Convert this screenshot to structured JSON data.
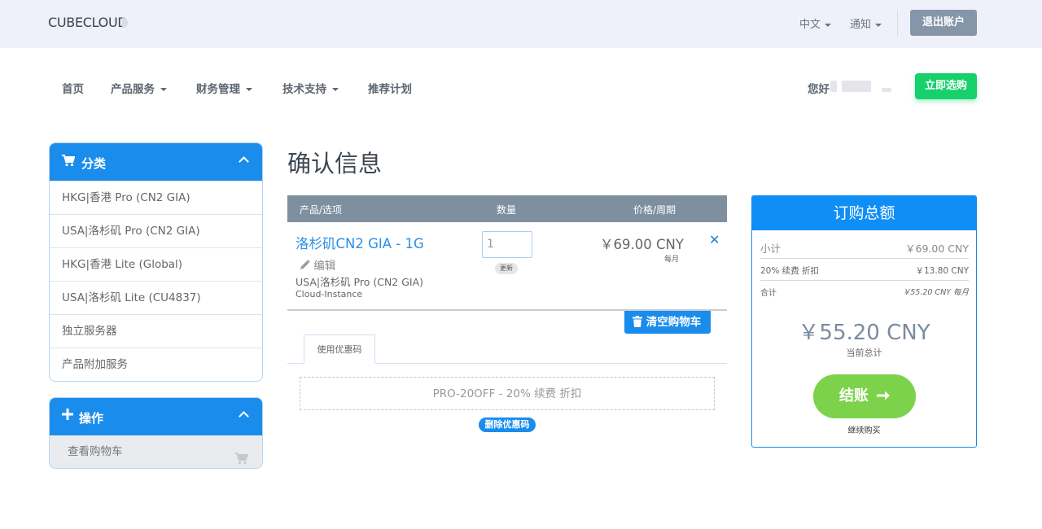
{
  "topbar": {
    "logo": "CUBECLOUD",
    "language": "中文",
    "notifications": "通知",
    "logout": "退出账户"
  },
  "nav": {
    "items": [
      "首页",
      "产品服务",
      "财务管理",
      "技术支持",
      "推荐计划"
    ],
    "greeting": "您好",
    "buy_now": "立即选购"
  },
  "sidebar": {
    "categories": {
      "title": "分类",
      "items": [
        "HKG|香港 Pro (CN2 GIA)",
        "USA|洛杉矶 Pro (CN2 GIA)",
        "HKG|香港 Lite (Global)",
        "USA|洛杉矶 Lite (CU4837)",
        "独立服务器",
        "产品附加服务"
      ]
    },
    "actions": {
      "title": "操作",
      "items": [
        "查看购物车"
      ]
    }
  },
  "main": {
    "title": "确认信息",
    "columns": {
      "product": "产品/选项",
      "qty": "数量",
      "price": "价格/周期"
    },
    "item": {
      "name": "洛杉矶CN2 GIA - 1G",
      "edit": "编辑",
      "group": "USA|洛杉矶 Pro (CN2 GIA)",
      "subtitle": "Cloud-Instance",
      "qty": "1",
      "update": "更新",
      "price": "￥69.00 CNY",
      "cycle": "每月",
      "remove": "✕"
    },
    "empty_cart": "清空购物车",
    "promo_tab": "使用优惠码",
    "promo_applied": "PRO-20OFF - 20% 续费 折扣",
    "remove_promo": "删除优惠码"
  },
  "summary": {
    "title": "订购总额",
    "subtotal_label": "小计",
    "subtotal": "￥69.00 CNY",
    "discount_label": "20% 续费 折扣",
    "discount": "￥13.80 CNY",
    "recurring_label": "合计",
    "recurring": "￥55.20 CNY 每月",
    "total": "￥55.20 CNY",
    "total_label": "当前总计",
    "checkout": "结账",
    "continue": "继续购买"
  },
  "colors": {
    "accent": "#1a8cec",
    "buy_green": "#16d06b",
    "checkout_green": "#7cd24a",
    "topbar_bg": "#eef1f9"
  }
}
